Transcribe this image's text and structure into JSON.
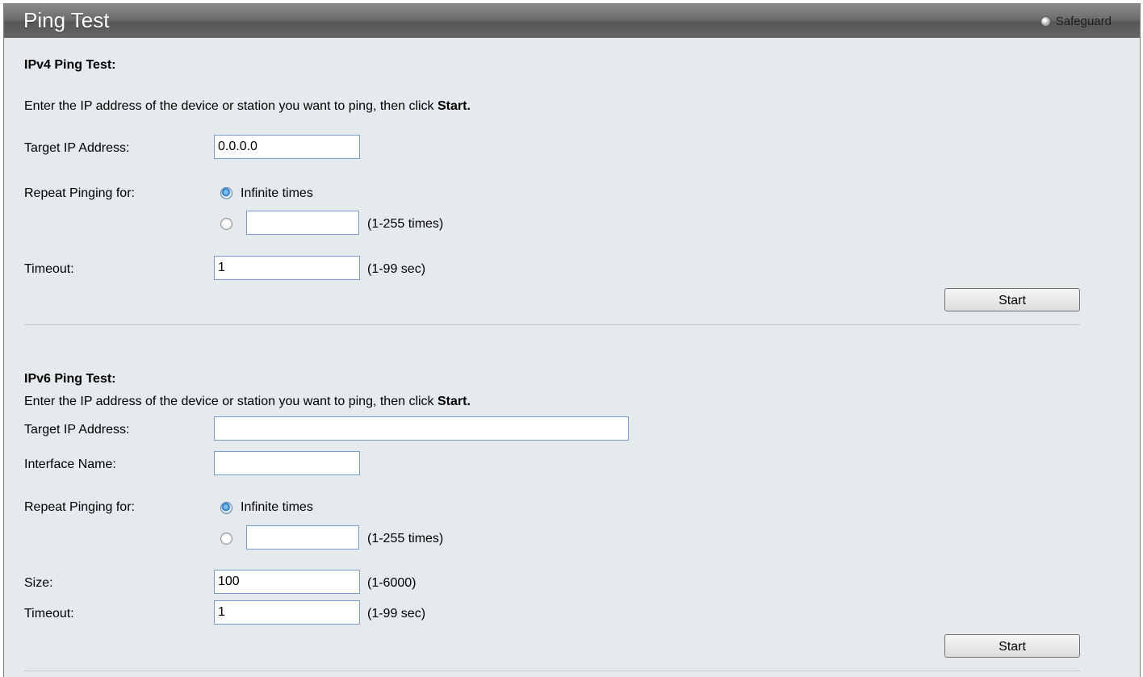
{
  "header": {
    "title": "Ping Test",
    "safeguard_label": "Safeguard"
  },
  "ipv4": {
    "heading": "IPv4 Ping Test:",
    "instruction_prefix": "Enter the IP address of the device or station you want to ping, then click ",
    "instruction_bold": "Start.",
    "target_label": "Target IP Address:",
    "target_value": "0.0.0.0",
    "repeat_label": "Repeat Pinging for:",
    "infinite_label": "Infinite times",
    "times_value": "",
    "times_range": "(1-255 times)",
    "timeout_label": "Timeout:",
    "timeout_value": "1",
    "timeout_range": "(1-99 sec)",
    "start_label": "Start",
    "repeat_mode": "infinite"
  },
  "ipv6": {
    "heading": "IPv6 Ping Test:",
    "instruction_prefix": "Enter the IP address of the device or station you want to ping, then click ",
    "instruction_bold": "Start.",
    "target_label": "Target IP Address:",
    "target_value": "",
    "interface_label": "Interface Name:",
    "interface_value": "",
    "repeat_label": "Repeat Pinging for:",
    "infinite_label": "Infinite times",
    "times_value": "",
    "times_range": "(1-255 times)",
    "size_label": "Size:",
    "size_value": "100",
    "size_range": "(1-6000)",
    "timeout_label": "Timeout:",
    "timeout_value": "1",
    "timeout_range": "(1-99 sec)",
    "start_label": "Start",
    "repeat_mode": "infinite"
  },
  "colors": {
    "title_bar": "#6d6d6d",
    "panel_bg": "#e5eaed",
    "input_border": "#7a9cc6"
  }
}
